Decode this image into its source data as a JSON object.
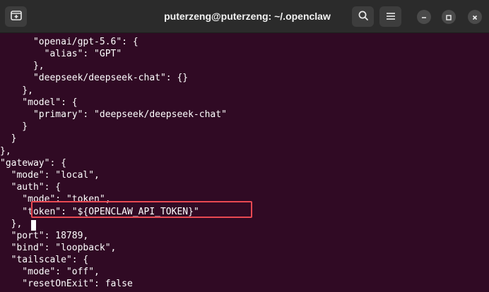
{
  "window": {
    "title": "puterzeng@puterzeng: ~/.openclaw"
  },
  "icons": {
    "new_tab": "new-tab-icon",
    "search": "search-icon",
    "menu": "hamburger-menu-icon",
    "minimize": "minimize-icon",
    "maximize": "maximize-icon",
    "close": "close-icon"
  },
  "colors": {
    "terminal_bg": "#300a24",
    "titlebar_bg": "#2b2b2b",
    "highlight": "#e94952"
  },
  "terminal": {
    "lines": [
      "      \"openai/gpt-5.6\": {",
      "        \"alias\": \"GPT\"",
      "      },",
      "      \"deepseek/deepseek-chat\": {}",
      "    },",
      "    \"model\": {",
      "      \"primary\": \"deepseek/deepseek-chat\"",
      "    }",
      "  }",
      "},",
      "\"gateway\": {",
      "  \"mode\": \"local\",",
      "  \"auth\": {",
      "    \"mode\": \"token\",",
      "    \"token\": \"${OPENCLAW_API_TOKEN}\"",
      "  },",
      "  \"port\": 18789,",
      "  \"bind\": \"loopback\",",
      "  \"tailscale\": {",
      "    \"mode\": \"off\",",
      "    \"resetOnExit\": false"
    ]
  }
}
